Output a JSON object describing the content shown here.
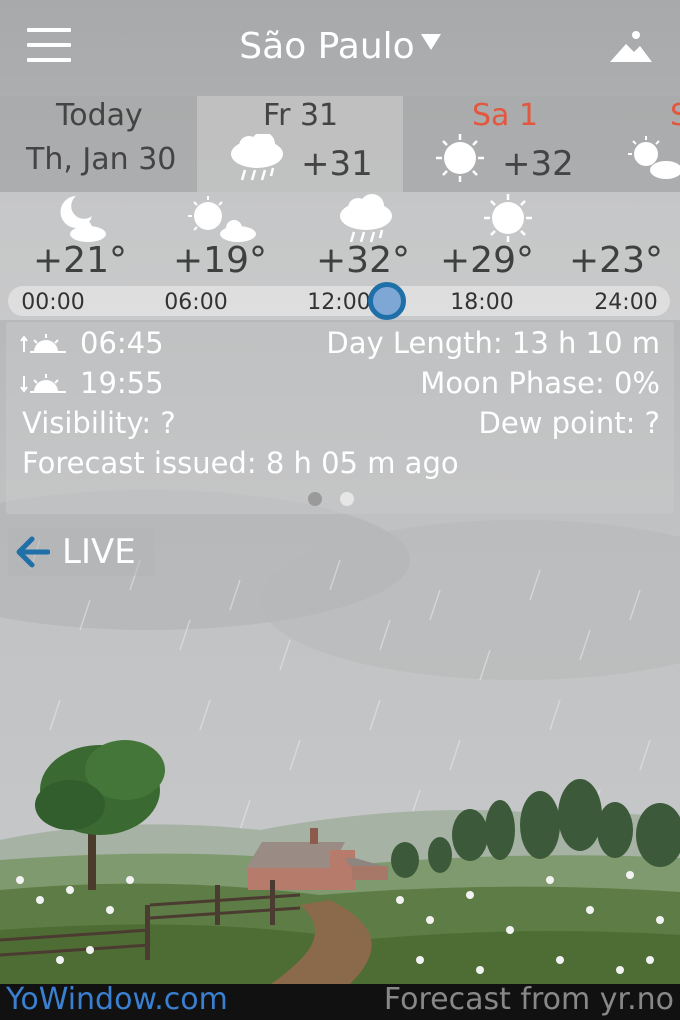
{
  "header": {
    "city": "São Paulo"
  },
  "days": [
    {
      "line1": "Today",
      "line2": "Th, Jan 30"
    },
    {
      "line1": "Fr 31",
      "temp": "+31",
      "icon": "rain-icon"
    },
    {
      "line1": "Sa 1",
      "temp": "+32",
      "icon": "sun-icon"
    },
    {
      "line1": "S",
      "icon": "sun-cloud-icon"
    }
  ],
  "hourly": {
    "items": [
      {
        "temp": "+21°",
        "icon": "moon-cloud-icon"
      },
      {
        "temp": "+19°",
        "icon": "sun-cloud-icon"
      },
      {
        "temp": "+32°",
        "icon": "rain-icon"
      },
      {
        "temp": "+29°",
        "icon": "sun-icon"
      },
      {
        "temp": "+23°",
        "icon": ""
      }
    ],
    "ticks": [
      "00:00",
      "06:00",
      "12:00",
      "18:00",
      "24:00"
    ]
  },
  "details": {
    "sunrise": "06:45",
    "sunset": "19:55",
    "day_length": "Day Length: 13 h 10 m",
    "moon_phase": "Moon Phase: 0%",
    "visibility": "Visibility: ?",
    "dew_point": "Dew point: ?",
    "issued": "Forecast issued: 8 h 05 m ago"
  },
  "live": {
    "label": "LIVE"
  },
  "footer": {
    "left": "YoWindow.com",
    "right": "Forecast from yr.no"
  },
  "colors": {
    "accent": "#1f70a8",
    "weekend": "#e2573f",
    "link": "#3a7fd0"
  }
}
